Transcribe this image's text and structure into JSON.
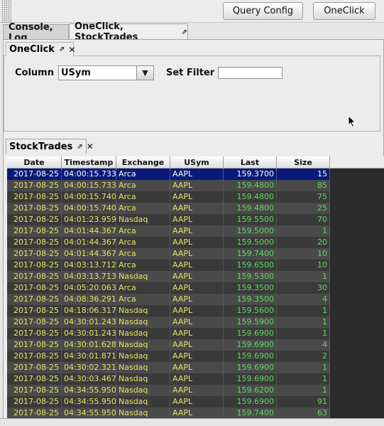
{
  "toolbar": {
    "query_config_label": "Query Config",
    "oneclick_label": "OneClick"
  },
  "tabs": [
    {
      "label": "Console, Log"
    },
    {
      "label": "OneClick, StockTrades"
    }
  ],
  "oneclick_panel": {
    "tab_label": "OneClick",
    "column_label": "Column :",
    "column_value": "USym",
    "filter_label": "Set Filter :",
    "filter_value": ""
  },
  "stocktrades_panel": {
    "tab_label": "StockTrades",
    "columns": [
      "Date",
      "Timestamp",
      "Exchange",
      "USym",
      "Last",
      "Size"
    ],
    "rows": [
      [
        "2017-08-25",
        "04:00:15.733",
        "Arca",
        "AAPL",
        "159.3700",
        "15"
      ],
      [
        "2017-08-25",
        "04:00:15.733",
        "Arca",
        "AAPL",
        "159.4800",
        "85"
      ],
      [
        "2017-08-25",
        "04:00:15.740",
        "Arca",
        "AAPL",
        "159.4800",
        "75"
      ],
      [
        "2017-08-25",
        "04:00:15.740",
        "Arca",
        "AAPL",
        "159.4800",
        "25"
      ],
      [
        "2017-08-25",
        "04:01:23.959",
        "Nasdaq",
        "AAPL",
        "159.5500",
        "70"
      ],
      [
        "2017-08-25",
        "04:01:44.367",
        "Arca",
        "AAPL",
        "159.5000",
        "1"
      ],
      [
        "2017-08-25",
        "04:01:44.367",
        "Arca",
        "AAPL",
        "159.5000",
        "20"
      ],
      [
        "2017-08-25",
        "04:01:44.367",
        "Arca",
        "AAPL",
        "159.7400",
        "10"
      ],
      [
        "2017-08-25",
        "04:03:13.712",
        "Arca",
        "AAPL",
        "159.6500",
        "10"
      ],
      [
        "2017-08-25",
        "04:03:13.713",
        "Nasdaq",
        "AAPL",
        "159.5300",
        "1"
      ],
      [
        "2017-08-25",
        "04:05:20.063",
        "Arca",
        "AAPL",
        "159.3500",
        "30"
      ],
      [
        "2017-08-25",
        "04:08:36.291",
        "Arca",
        "AAPL",
        "159.3500",
        "4"
      ],
      [
        "2017-08-25",
        "04:18:06.317",
        "Nasdaq",
        "AAPL",
        "159.5600",
        "1"
      ],
      [
        "2017-08-25",
        "04:30:01.243",
        "Nasdaq",
        "AAPL",
        "159.5900",
        "1"
      ],
      [
        "2017-08-25",
        "04:30:01.243",
        "Nasdaq",
        "AAPL",
        "159.6900",
        "1"
      ],
      [
        "2017-08-25",
        "04:30:01.628",
        "Nasdaq",
        "AAPL",
        "159.6900",
        "4"
      ],
      [
        "2017-08-25",
        "04:30:01.871",
        "Nasdaq",
        "AAPL",
        "159.6900",
        "2"
      ],
      [
        "2017-08-25",
        "04:30:02.321",
        "Nasdaq",
        "AAPL",
        "159.6900",
        "1"
      ],
      [
        "2017-08-25",
        "04:30:03.467",
        "Nasdaq",
        "AAPL",
        "159.6900",
        "1"
      ],
      [
        "2017-08-25",
        "04:34:55.950",
        "Nasdaq",
        "AAPL",
        "159.6200",
        "1"
      ],
      [
        "2017-08-25",
        "04:34:55.950",
        "Nasdaq",
        "AAPL",
        "159.6900",
        "91"
      ],
      [
        "2017-08-25",
        "04:34:55.950",
        "Nasdaq",
        "AAPL",
        "159.7400",
        "63"
      ]
    ]
  }
}
